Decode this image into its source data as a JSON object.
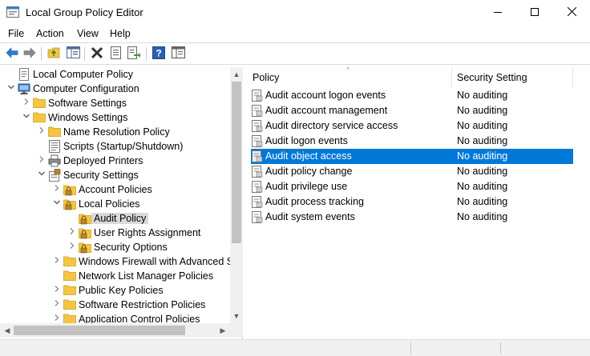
{
  "window": {
    "title": "Local Group Policy Editor",
    "app_icon": "group-policy-icon",
    "controls": [
      "minimize-icon",
      "maximize-icon",
      "close-icon"
    ]
  },
  "menu": {
    "items": [
      {
        "label": "File"
      },
      {
        "label": "Action"
      },
      {
        "label": "View"
      },
      {
        "label": "Help"
      }
    ]
  },
  "toolbar": {
    "buttons": [
      "back-icon",
      "forward-icon",
      "up-folder-icon",
      "show-hide-tree-icon",
      "delete-icon",
      "properties-icon",
      "export-list-icon",
      "help-icon",
      "extended-view-icon"
    ]
  },
  "tree": {
    "items": [
      {
        "label": "Local Computer Policy",
        "icon": "computer-policy-icon",
        "expander": ""
      },
      {
        "label": "Computer Configuration",
        "icon": "computer-icon",
        "expander": "expanded"
      },
      {
        "label": "Software Settings",
        "icon": "folder-icon",
        "expander": "collapsed"
      },
      {
        "label": "Windows Settings",
        "icon": "folder-icon",
        "expander": "expanded"
      },
      {
        "label": "Name Resolution Policy",
        "icon": "folder-icon",
        "expander": "collapsed"
      },
      {
        "label": "Scripts (Startup/Shutdown)",
        "icon": "script-icon",
        "expander": ""
      },
      {
        "label": "Deployed Printers",
        "icon": "printer-icon",
        "expander": "collapsed"
      },
      {
        "label": "Security Settings",
        "icon": "security-settings-icon",
        "expander": "expanded"
      },
      {
        "label": "Account Policies",
        "icon": "locked-folder-icon",
        "expander": "collapsed"
      },
      {
        "label": "Local Policies",
        "icon": "locked-folder-icon",
        "expander": "expanded"
      },
      {
        "label": "Audit Policy",
        "icon": "locked-folder-icon",
        "expander": "",
        "selected": true
      },
      {
        "label": "User Rights Assignment",
        "icon": "locked-folder-icon",
        "expander": "collapsed"
      },
      {
        "label": "Security Options",
        "icon": "locked-folder-icon",
        "expander": "collapsed"
      },
      {
        "label": "Windows Firewall with Advanced S",
        "icon": "folder-icon",
        "expander": "collapsed"
      },
      {
        "label": "Network List Manager Policies",
        "icon": "folder-icon",
        "expander": ""
      },
      {
        "label": "Public Key Policies",
        "icon": "folder-icon",
        "expander": "collapsed"
      },
      {
        "label": "Software Restriction Policies",
        "icon": "folder-icon",
        "expander": "collapsed"
      },
      {
        "label": "Application Control Policies",
        "icon": "folder-icon",
        "expander": "collapsed"
      }
    ]
  },
  "list": {
    "columns": {
      "policy": "Policy",
      "setting": "Security Setting"
    },
    "rows": [
      {
        "policy": "Audit account logon events",
        "setting": "No auditing"
      },
      {
        "policy": "Audit account management",
        "setting": "No auditing"
      },
      {
        "policy": "Audit directory service access",
        "setting": "No auditing"
      },
      {
        "policy": "Audit logon events",
        "setting": "No auditing"
      },
      {
        "policy": "Audit object access",
        "setting": "No auditing",
        "selected": true
      },
      {
        "policy": "Audit policy change",
        "setting": "No auditing"
      },
      {
        "policy": "Audit privilege use",
        "setting": "No auditing"
      },
      {
        "policy": "Audit process tracking",
        "setting": "No auditing"
      },
      {
        "policy": "Audit system events",
        "setting": "No auditing"
      }
    ]
  },
  "colors": {
    "selection": "#0078d7",
    "tree_selection": "#d9d9d9",
    "folder": "#f5c542"
  }
}
